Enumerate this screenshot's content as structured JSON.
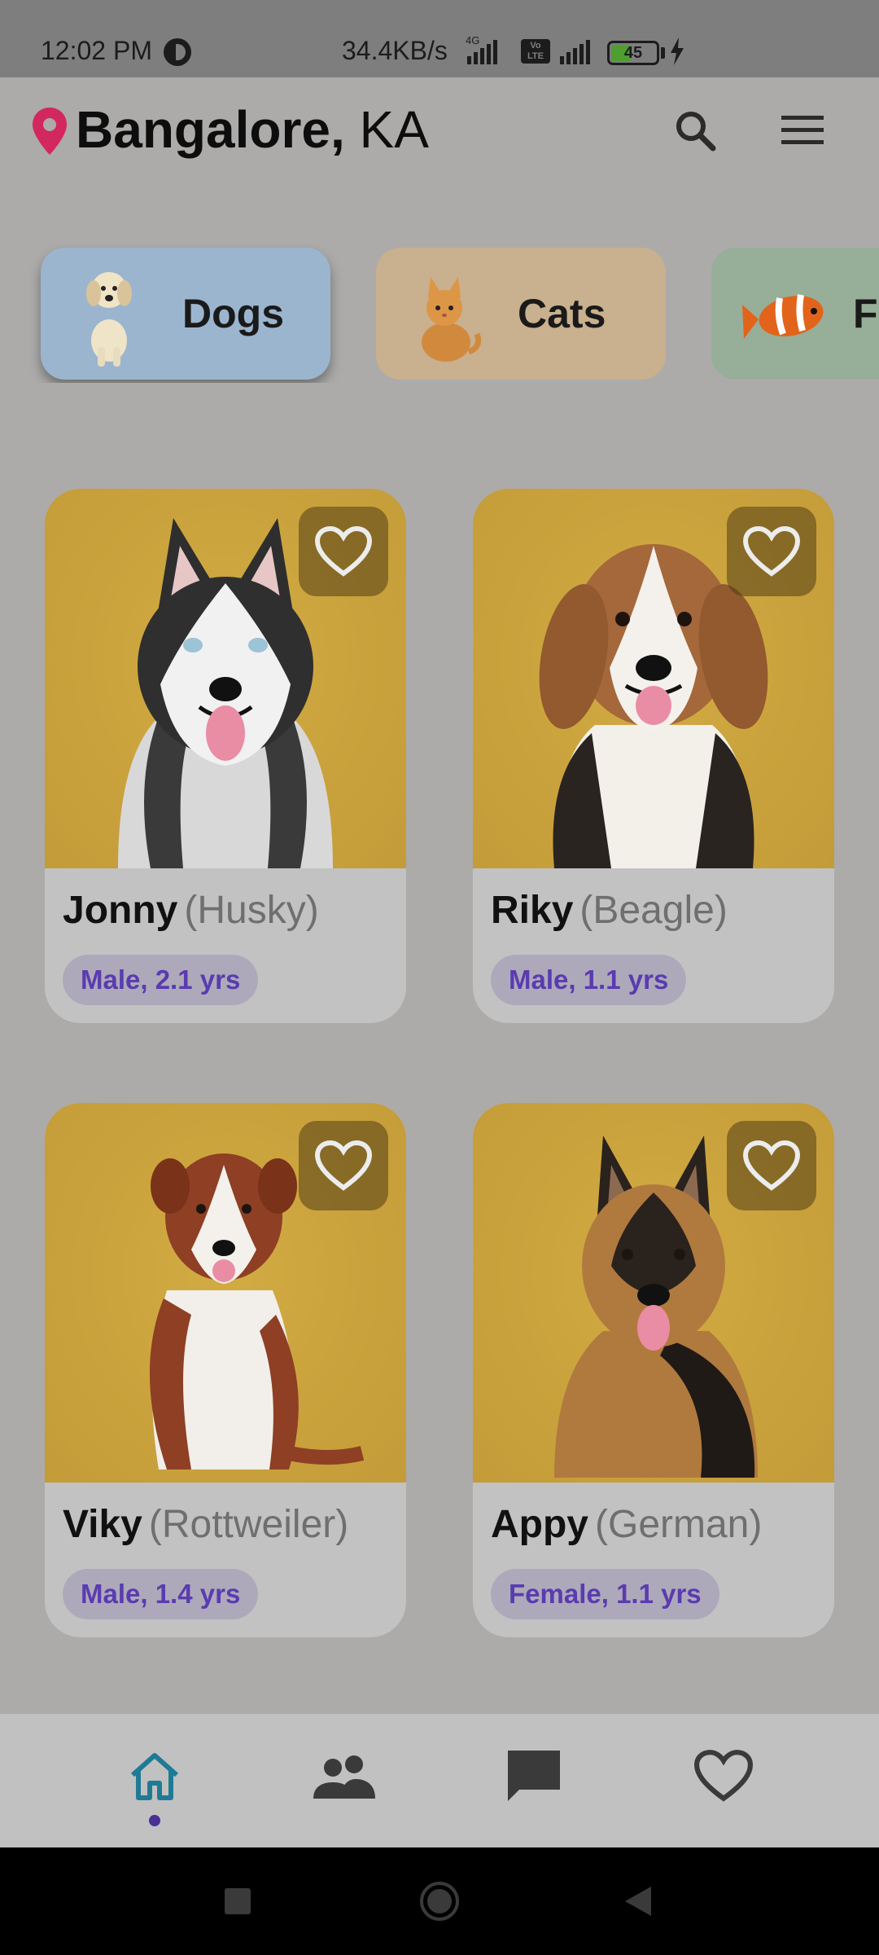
{
  "status_bar": {
    "time": "12:02 PM",
    "speed": "34.4KB/s",
    "network": "4G",
    "volte": "Vo LTE",
    "battery_level": "45",
    "battery_fraction": 0.45
  },
  "header": {
    "city": "Bangalore,",
    "state": "KA",
    "search_icon": "search-icon",
    "menu_icon": "menu-icon"
  },
  "categories": [
    {
      "label": "Dogs",
      "color": "#9bb5ce",
      "active": true
    },
    {
      "label": "Cats",
      "color": "#c9b08e",
      "active": false
    },
    {
      "label": "Fi",
      "color": "#97ae98",
      "active": false
    }
  ],
  "pets": [
    {
      "name": "Jonny",
      "breed": "(Husky)",
      "info": "Male, 2.1 yrs"
    },
    {
      "name": "Riky",
      "breed": "(Beagle)",
      "info": "Male, 1.1 yrs"
    },
    {
      "name": "Viky",
      "breed": "(Rottweiler)",
      "info": "Male, 1.4 yrs"
    },
    {
      "name": "Appy",
      "breed": "(German)",
      "info": "Female, 1.1 yrs"
    }
  ],
  "bottom_nav": {
    "items": [
      "home-icon",
      "people-icon",
      "chat-icon",
      "favorites-icon"
    ],
    "active": "home-icon",
    "active_color": "#1f7b95"
  },
  "colors": {
    "pin": "#d3275f",
    "badge_text": "#5a3bb0",
    "card_photo_bg": "#c9a13c"
  }
}
